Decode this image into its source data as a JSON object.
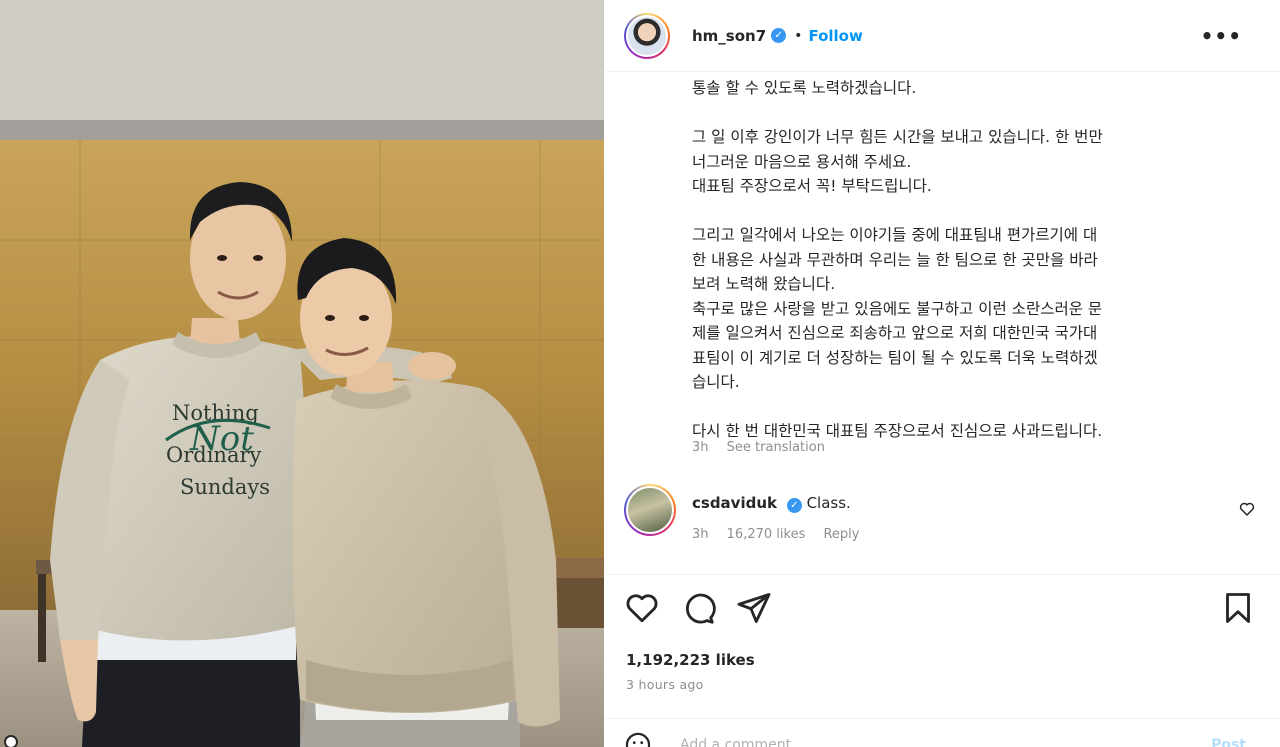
{
  "post": {
    "username": "hm_son7",
    "separator": "•",
    "follow_label": "Follow",
    "more_label": "•••"
  },
  "caption": {
    "text": "통솔 할 수 있도록 노력하겠습니다.\n\n그 일 이후 강인이가 너무 힘든 시간을 보내고 있습니다. 한 번만\n너그러운 마음으로 용서해 주세요.\n대표팀 주장으로서 꼭! 부탁드립니다.\n\n그리고 일각에서 나오는 이야기들 중에 대표팀내 편가르기에 대\n한 내용은 사실과 무관하며 우리는 늘 한 팀으로 한 곳만을 바라\n보려 노력해 왔습니다.\n축구로 많은 사랑을 받고 있음에도 불구하고 이런 소란스러운 문\n제를 일으켜서 진심으로 죄송하고 앞으로 저희 대한민국 국가대\n표팀이 이 계기로 더 성장하는 팀이 될 수 있도록 더욱 노력하겠\n습니다.\n\n다시 한 번 대한민국 대표팀 주장으로서 진심으로 사과드립니다.",
    "time": "3h",
    "see_translation": "See translation"
  },
  "comment": {
    "username": "csdaviduk",
    "text": "Class.",
    "time": "3h",
    "likes": "16,270 likes",
    "reply": "Reply"
  },
  "stats": {
    "likes": "1,192,223 likes",
    "time_ago": "3 hours ago"
  },
  "add_comment": {
    "placeholder": "Add a comment...",
    "post_label": "Post"
  },
  "photo": {
    "shirt_text_line1": "Nothing",
    "shirt_text_line2": "Ordinary",
    "shirt_text_line3": "Sundays",
    "shirt_script": "Not"
  },
  "icons": {
    "like": "heart-icon",
    "comment": "comment-icon",
    "share": "paper-plane-icon",
    "save": "bookmark-icon",
    "emoji": "smiley-icon"
  },
  "colors": {
    "link_blue": "#0095f6",
    "verified_blue": "#3897f0",
    "muted": "#8e8e8e"
  }
}
